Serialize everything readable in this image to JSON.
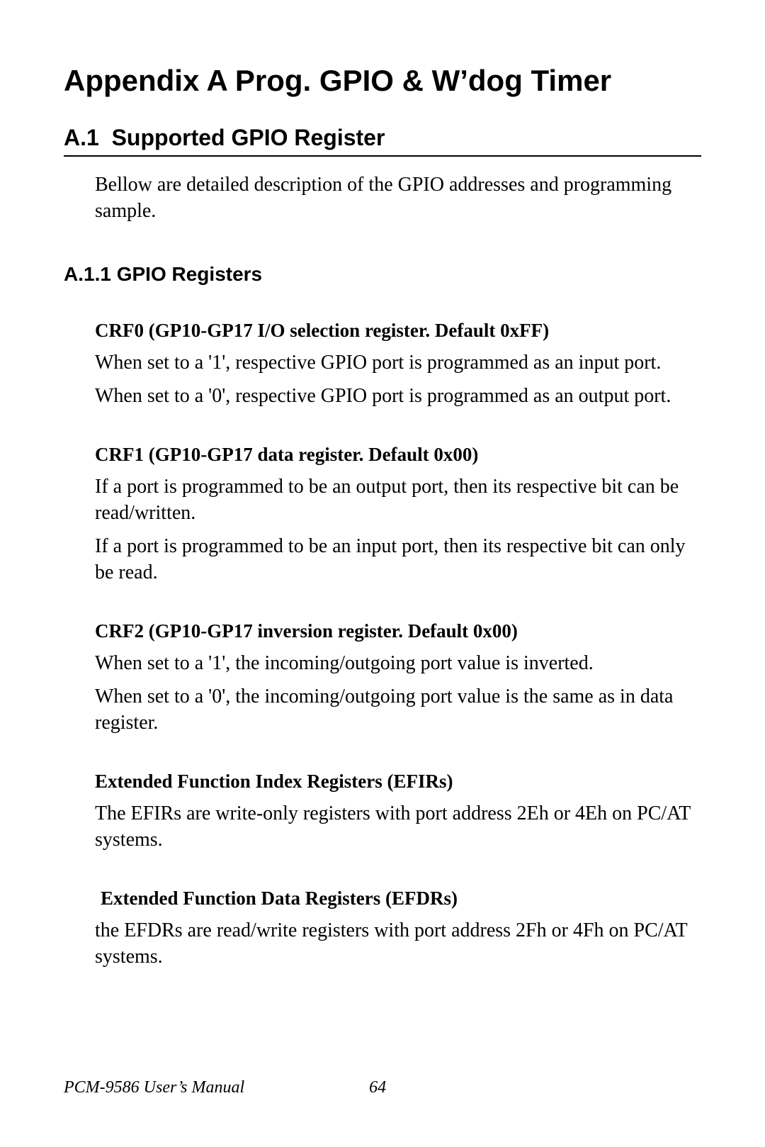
{
  "title": "Appendix A  Prog. GPIO & W’dog Timer",
  "section": {
    "number": "A.1",
    "title": "Supported GPIO Register",
    "intro": "Bellow are detailed description of the GPIO addresses and programming sample."
  },
  "subsection": {
    "number": "A.1.1",
    "title": "GPIO Registers"
  },
  "regs": [
    {
      "title": "CRF0 (GP10-GP17 I/O selection register. Default 0xFF)",
      "paras": [
        "When set to a '1', respective GPIO port is programmed as an input port.",
        "When set to a '0', respective GPIO port is programmed as an output port."
      ]
    },
    {
      "title": "CRF1 (GP10-GP17 data register. Default 0x00)",
      "paras": [
        "If a port is programmed to be an output port, then its respective bit can be read/written.",
        "If a port is programmed to be an input port, then its respective bit can only be read."
      ]
    },
    {
      "title": "CRF2 (GP10-GP17 inversion register. Default 0x00)",
      "paras": [
        "When set to a '1', the incoming/outgoing port value is inverted.",
        "When set to a '0', the incoming/outgoing port value is the same as in data register."
      ]
    },
    {
      "title": "Extended Function Index Registers (EFIRs)",
      "paras": [
        "The EFIRs are write-only registers with port address 2Eh or 4Eh on PC/AT systems."
      ]
    },
    {
      "title": "Extended Function Data Registers (EFDRs)",
      "paras": [
        "the EFDRs are read/write registers with port address 2Fh or 4Fh on PC/AT systems."
      ],
      "nudge": true
    }
  ],
  "footer": {
    "manual": "PCM-9586 User’s Manual",
    "page": "64"
  }
}
